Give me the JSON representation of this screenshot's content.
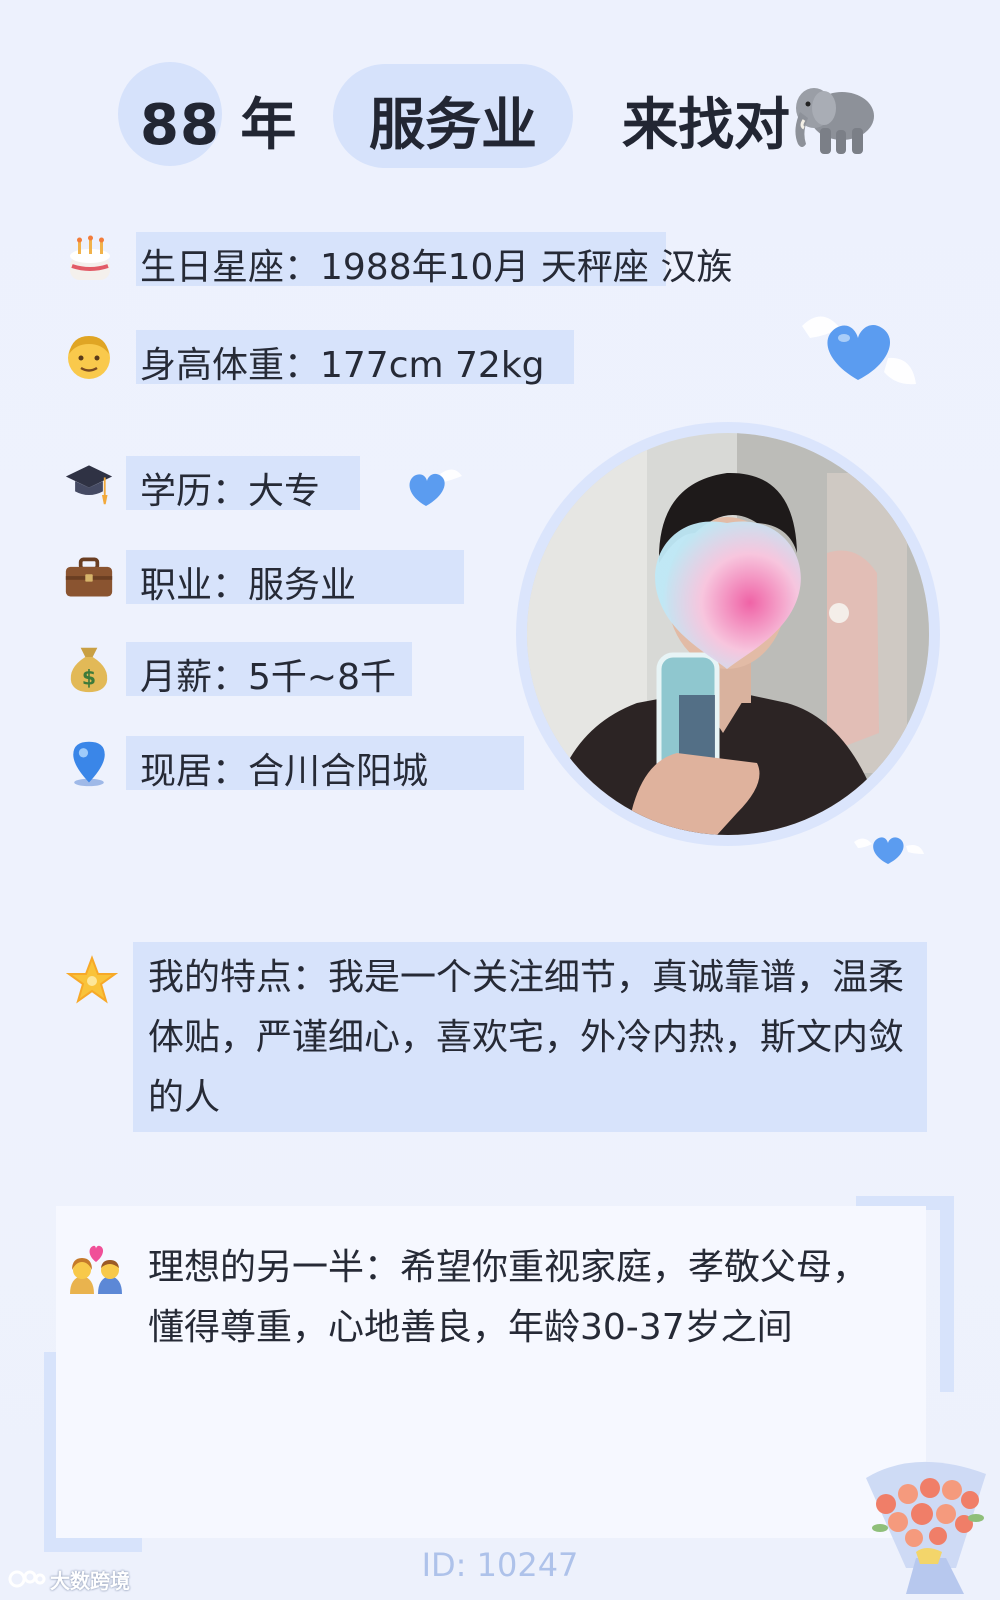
{
  "header": {
    "age": "88 年",
    "job": "服务业",
    "seek": "来找对"
  },
  "info_rows": [
    {
      "icon": "birthday-cake-icon",
      "text": "生日星座：1988年10月 天秤座 汉族"
    },
    {
      "icon": "man-face-icon",
      "text": "身高体重：177cm 72kg"
    },
    {
      "icon": "graduation-cap-icon",
      "text": "学历：大专"
    },
    {
      "icon": "briefcase-icon",
      "text": "职业：服务业"
    },
    {
      "icon": "money-bag-icon",
      "text": "月薪：5千~8千"
    },
    {
      "icon": "location-pin-icon",
      "text": "现居：合川合阳城"
    }
  ],
  "features": {
    "icon": "glowing-star-icon",
    "text": "我的特点：我是一个关注细节，真诚靠谱，温柔体贴，严谨细心，喜欢宅，外冷内热，斯文内敛的人"
  },
  "ideal": {
    "icon": "couple-with-heart-icon",
    "text": "理想的另一半：希望你重视家庭，孝敬父母，懂得尊重，心地善良，年龄30-37岁之间"
  },
  "footer": {
    "id": "ID: 10247",
    "watermark": "大数跨境"
  },
  "colors": {
    "background": "#eef2fd",
    "highlight": "#d7e3fb",
    "accent_blue": "#5b9cf0",
    "id_text": "#aec2ea"
  }
}
